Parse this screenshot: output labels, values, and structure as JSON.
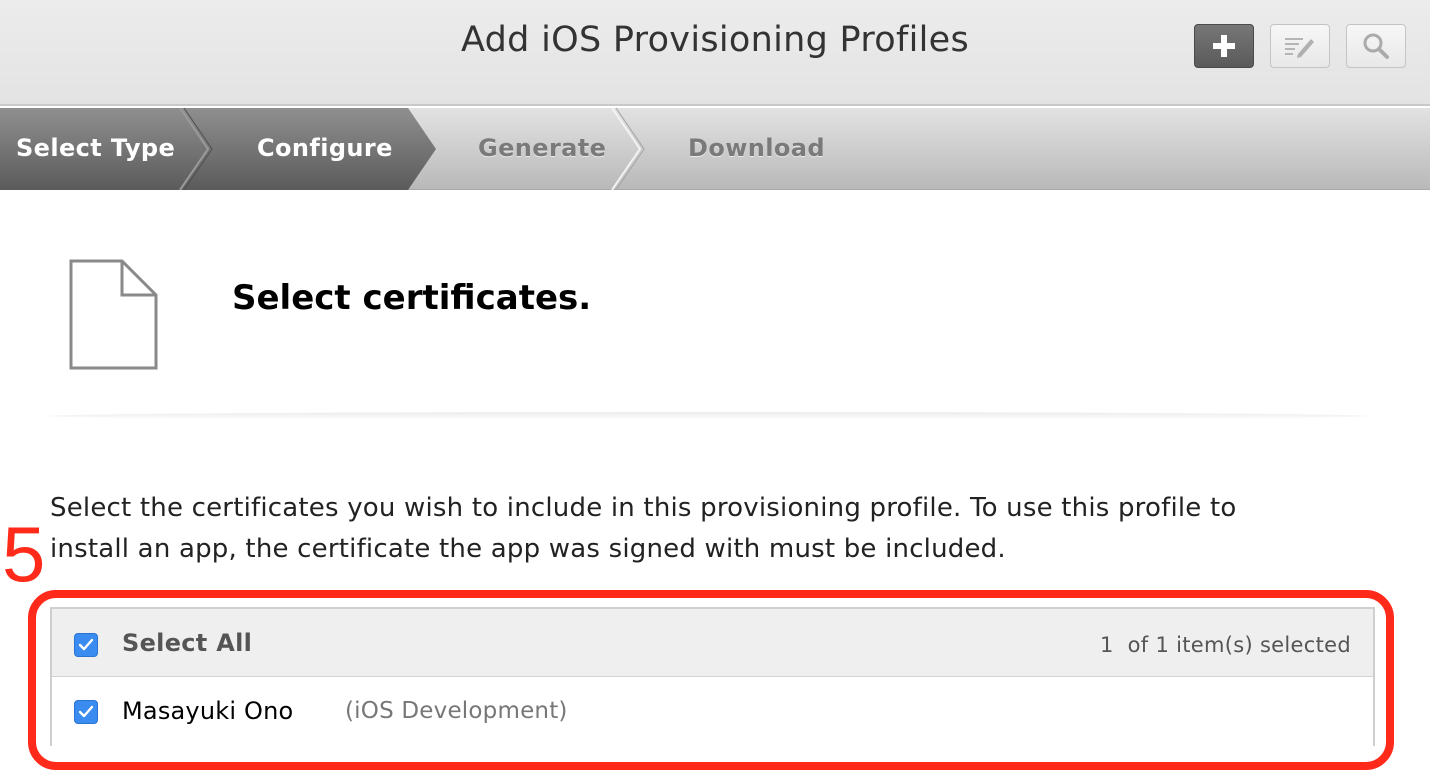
{
  "header": {
    "title": "Add iOS Provisioning Profiles",
    "buttons": {
      "add_icon": "plus-icon",
      "edit_icon": "edit-icon",
      "search_icon": "search-icon"
    }
  },
  "steps": [
    {
      "label": "Select Type",
      "state": "active"
    },
    {
      "label": "Configure",
      "state": "active"
    },
    {
      "label": "Generate",
      "state": "inactive"
    },
    {
      "label": "Download",
      "state": "inactive"
    }
  ],
  "section": {
    "icon": "document-icon",
    "title": "Select certificates."
  },
  "description": {
    "line1": "Select the certificates you wish to include in this provisioning profile. To use this profile to",
    "line2": "install an app, the certificate the app was signed with must be included."
  },
  "annotation": {
    "number": "5",
    "color": "#ff2a1a"
  },
  "certificates": {
    "select_all_label": "Select All",
    "select_all_checked": true,
    "selected_count": "1",
    "selected_suffix": "of 1 item(s) selected",
    "items": [
      {
        "name": "Masayuki Ono",
        "type": "(iOS Development)",
        "checked": true
      }
    ]
  },
  "colors": {
    "checkbox_accent": "#3b8cf0",
    "annotation_red": "#ff2a1a"
  }
}
